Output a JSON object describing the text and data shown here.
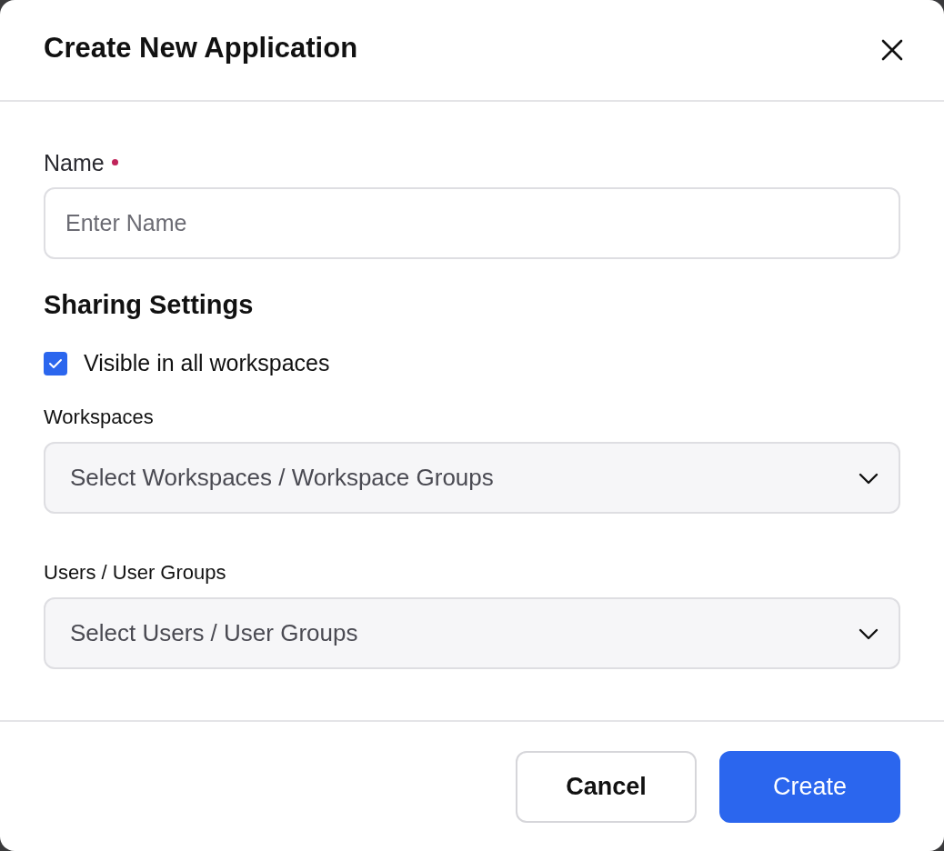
{
  "dialog": {
    "title": "Create New Application"
  },
  "name_field": {
    "label": "Name",
    "required": true,
    "placeholder": "Enter Name"
  },
  "sharing": {
    "heading": "Sharing Settings",
    "checkbox": {
      "label": "Visible in all workspaces",
      "checked": true
    }
  },
  "selects": [
    {
      "label": "Workspaces",
      "placeholder": "Select Workspaces / Workspace Groups"
    },
    {
      "label": "Users / User Groups",
      "placeholder": "Select Users / User Groups"
    }
  ],
  "buttons": [
    {
      "label": "Cancel",
      "kind": "secondary"
    },
    {
      "label": "Create",
      "kind": "primary"
    }
  ]
}
